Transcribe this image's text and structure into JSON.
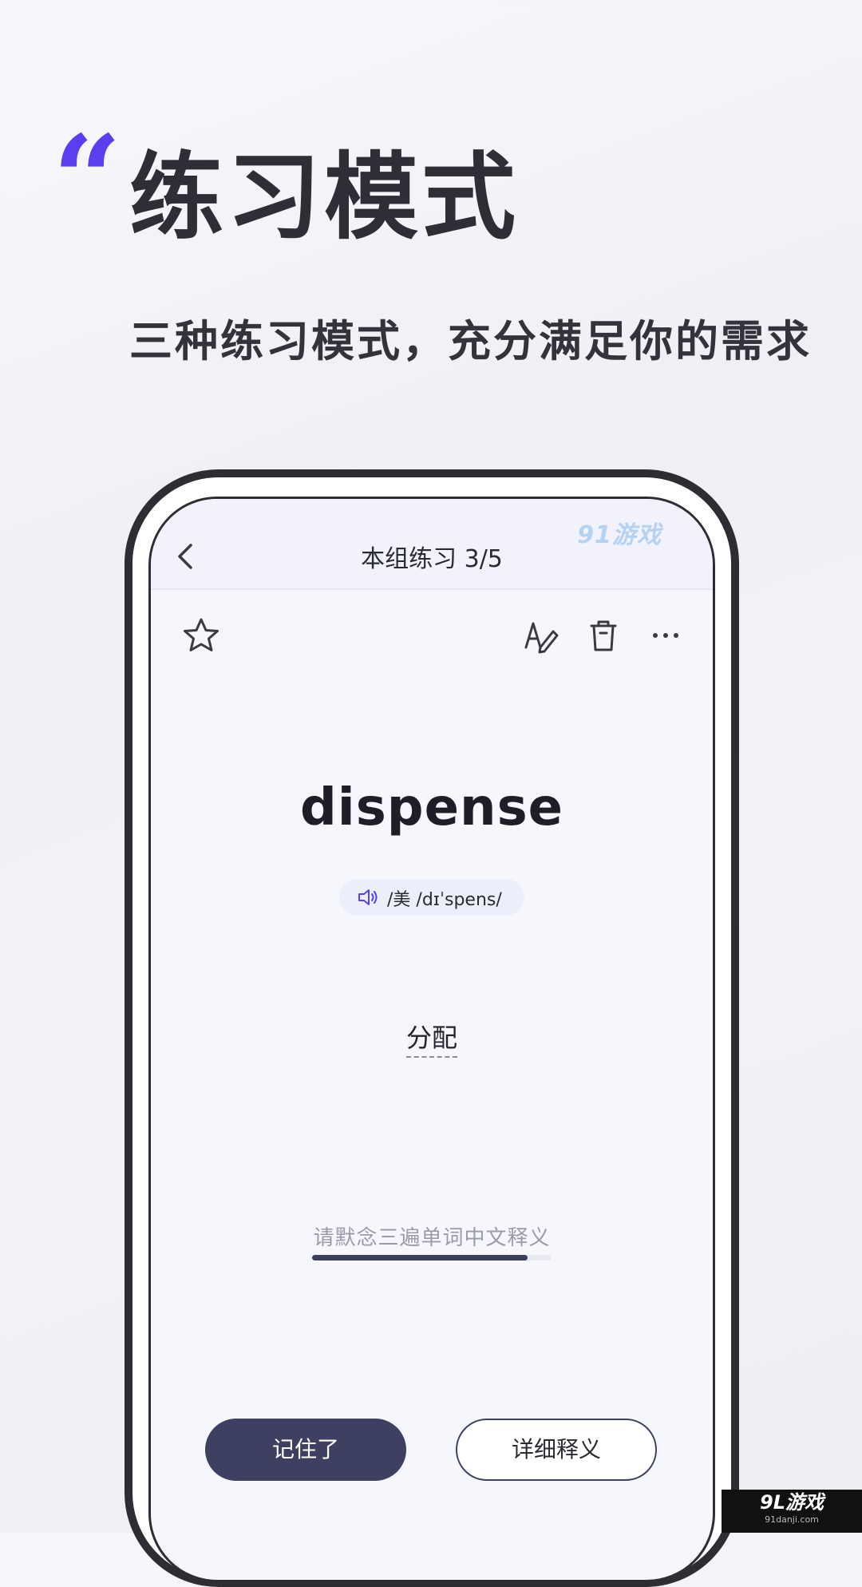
{
  "marketing": {
    "quote_glyph": "“",
    "headline": "练习模式",
    "subheadline": "三种练习模式，充分满足你的需求"
  },
  "nav": {
    "title": "本组练习  3/5",
    "watermark": "91游戏",
    "back_icon": "chevron-left-icon"
  },
  "toolbar": {
    "favorite_icon": "star-icon",
    "edit_icon": "edit-pen-icon",
    "delete_icon": "trash-icon",
    "more_icon": "more-dots-icon"
  },
  "card": {
    "word": "dispense",
    "pronunciation": "/美  /dɪˈspens/",
    "meaning": "分配",
    "hint": "请默念三遍单词中文释义",
    "progress_fraction": 0.9
  },
  "actions": {
    "remembered_label": "记住了",
    "details_label": "详细释义"
  },
  "corner_badge": {
    "logo": "9L游戏",
    "url": "91danji.com"
  },
  "colors": {
    "accent_quote": "#5a3ff0",
    "primary_button": "#3d4060",
    "progress_fill": "#3c3f5c"
  }
}
